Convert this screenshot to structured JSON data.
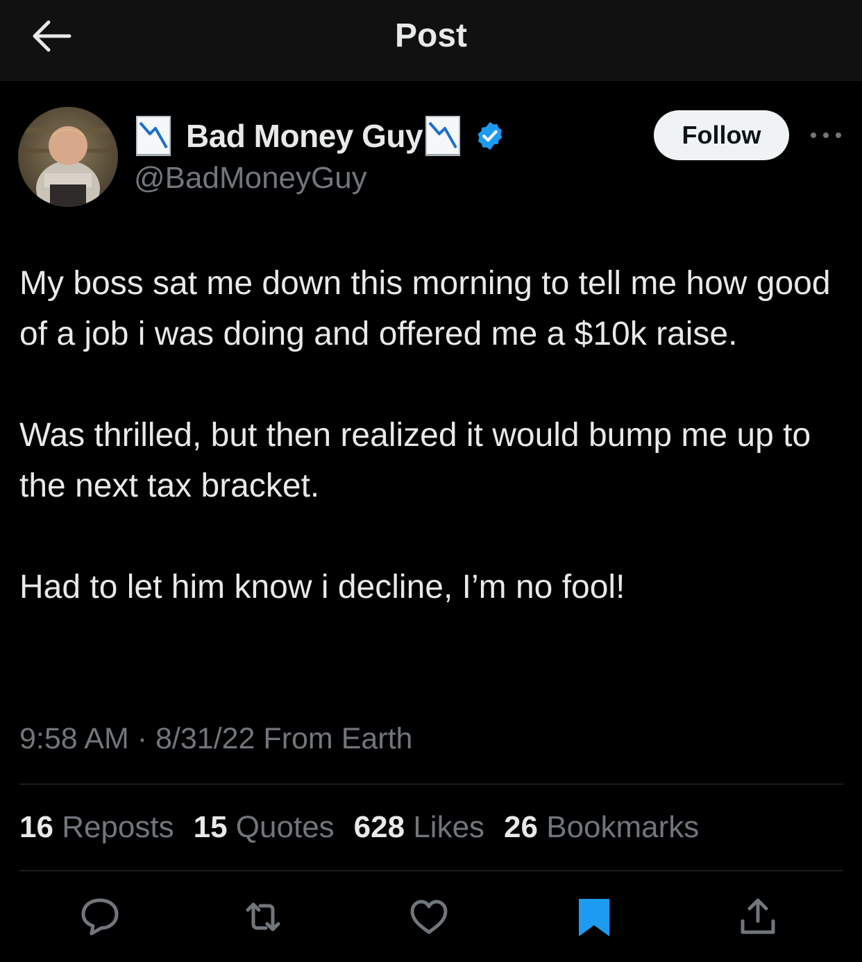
{
  "header": {
    "title": "Post"
  },
  "author": {
    "display_name": "Bad Money Guy",
    "handle": "@BadMoneyGuy",
    "verified": true,
    "follow_label": "Follow"
  },
  "post": {
    "paragraphs": [
      "My boss sat me down this morning to tell me how good of a job i was doing and offered me a $10k raise.",
      "Was thrilled, but then realized it would bump me up to the next tax bracket.",
      "Had to let him know i decline, I’m no fool!"
    ],
    "time": "9:58 AM",
    "separator": "·",
    "date": "8/31/22",
    "source": "From Earth"
  },
  "stats": [
    {
      "count": "16",
      "label": "Reposts"
    },
    {
      "count": "15",
      "label": "Quotes"
    },
    {
      "count": "628",
      "label": "Likes"
    },
    {
      "count": "26",
      "label": "Bookmarks"
    }
  ],
  "actions": [
    {
      "icon": "reply-icon"
    },
    {
      "icon": "repost-icon"
    },
    {
      "icon": "like-icon"
    },
    {
      "icon": "bookmark-icon",
      "active": true
    },
    {
      "icon": "share-icon"
    }
  ],
  "colors": {
    "background": "#000000",
    "header_bg": "#111111",
    "text_primary": "#e7e9ea",
    "text_secondary": "#71767b",
    "verified_blue": "#1d9bf0",
    "bookmark_active": "#1d9bf0",
    "follow_bg": "#eff3f4"
  }
}
